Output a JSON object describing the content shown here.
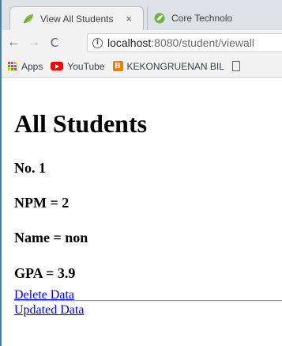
{
  "browser": {
    "tabs": [
      {
        "title": "View All Students",
        "close": "×",
        "icon": "leaf-icon",
        "active": true
      },
      {
        "title": "Core Technolo",
        "icon": "spring-icon",
        "active": false
      }
    ],
    "nav": {
      "back": "←",
      "forward": "→",
      "reload": "C"
    },
    "address": {
      "info": "i",
      "host": "localhost",
      "path": ":8080/student/viewall"
    },
    "bookmarks": [
      {
        "label": "Apps",
        "icon": "apps-grid-icon"
      },
      {
        "label": "YouTube",
        "icon": "youtube-icon"
      },
      {
        "label": "KEKONGRUENAN BIL",
        "icon": "blogger-icon",
        "icon_text": "B"
      },
      {
        "label": "",
        "icon": "document-icon"
      }
    ]
  },
  "page": {
    "title": "All Students",
    "student": {
      "number": "No. 1",
      "npm": "NPM = 2",
      "name": "Name = non",
      "gpa": "GPA = 3.9"
    },
    "links": {
      "delete": "Delete Data",
      "update": "Updated Data"
    }
  },
  "colors": {
    "link": "#0000ee",
    "tabstrip": "#dee1e6",
    "toolbar": "#f2f2f2",
    "youtube": "#ff0000",
    "blogger": "#f57d00"
  }
}
